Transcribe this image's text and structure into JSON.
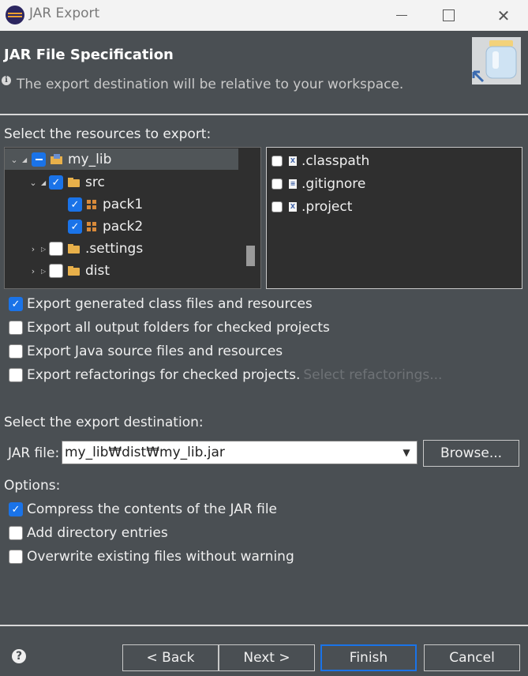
{
  "window": {
    "title": "JAR Export",
    "minimize": "",
    "maximize": "",
    "close": "✕"
  },
  "header": {
    "title": "JAR File Specification",
    "message": "The export destination will be relative to your workspace."
  },
  "resources": {
    "label": "Select the resources to export:",
    "tree": [
      {
        "label": "my_lib",
        "state": "partial",
        "expanded": true
      },
      {
        "label": "src",
        "state": "checked",
        "expanded": true
      },
      {
        "label": "pack1",
        "state": "checked"
      },
      {
        "label": "pack2",
        "state": "checked"
      },
      {
        "label": ".settings",
        "state": "unchecked",
        "expanded": false
      },
      {
        "label": "dist",
        "state": "unchecked",
        "expanded": false
      }
    ],
    "files": [
      {
        "label": ".classpath",
        "icon": "xml-file-icon",
        "checked": false
      },
      {
        "label": ".gitignore",
        "icon": "text-file-icon",
        "checked": false
      },
      {
        "label": ".project",
        "icon": "xml-file-icon",
        "checked": false
      }
    ]
  },
  "export_options": [
    {
      "label": "Export generated class files and resources",
      "checked": true
    },
    {
      "label": "Export all output folders for checked projects",
      "checked": false
    },
    {
      "label": "Export Java source files and resources",
      "checked": false
    },
    {
      "label": "Export refactorings for checked projects.",
      "checked": false,
      "link": "Select refactorings..."
    }
  ],
  "destination": {
    "label": "Select the export destination:",
    "jar_label": "JAR file:",
    "jar_value": "my_lib₩dist₩my_lib.jar",
    "browse": "Browse..."
  },
  "options": {
    "label": "Options:",
    "items": [
      {
        "label": "Compress the contents of the JAR file",
        "checked": true
      },
      {
        "label": "Add directory entries",
        "checked": false
      },
      {
        "label": "Overwrite existing files without warning",
        "checked": false
      }
    ]
  },
  "footer": {
    "back": "< Back",
    "next": "Next >",
    "finish": "Finish",
    "cancel": "Cancel"
  },
  "colors": {
    "background": "#4a4f53",
    "accent": "#1a73e8",
    "tree_background": "#2f2f2f"
  }
}
